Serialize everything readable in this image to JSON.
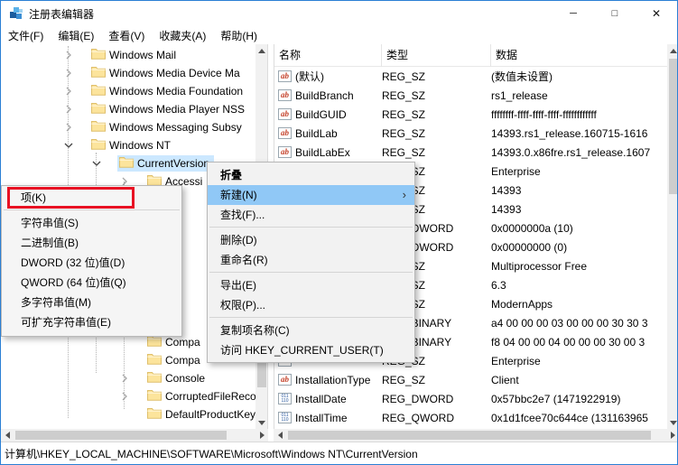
{
  "window": {
    "title": "注册表编辑器",
    "controls": [
      {
        "key": "minimize",
        "glyph": "─"
      },
      {
        "key": "maximize",
        "glyph": "□"
      },
      {
        "key": "close",
        "glyph": "✕"
      }
    ]
  },
  "menubar": [
    {
      "key": "file",
      "label": "文件(F)"
    },
    {
      "key": "edit",
      "label": "编辑(E)"
    },
    {
      "key": "view",
      "label": "查看(V)"
    },
    {
      "key": "favorites",
      "label": "收藏夹(A)"
    },
    {
      "key": "help",
      "label": "帮助(H)"
    }
  ],
  "tree": {
    "items": [
      {
        "label": "Windows Mail",
        "level": 0,
        "state": "collapsed",
        "section": "above_menu"
      },
      {
        "label": "Windows Media Device Ma",
        "level": 0,
        "state": "collapsed",
        "section": "above_menu"
      },
      {
        "label": "Windows Media Foundation",
        "level": 0,
        "state": "collapsed",
        "section": "above_menu"
      },
      {
        "label": "Windows Media Player NSS",
        "level": 0,
        "state": "collapsed",
        "section": "above_menu"
      },
      {
        "label": "Windows Messaging Subsy",
        "level": 0,
        "state": "collapsed",
        "section": "above_menu"
      },
      {
        "label": "Windows NT",
        "level": 0,
        "state": "expanded",
        "section": "above_menu"
      },
      {
        "label": "CurrentVersion",
        "level": 1,
        "state": "expanded",
        "section": "above_menu",
        "selected": true
      },
      {
        "label": "Accessi",
        "level": 2,
        "state": "collapsed",
        "section": "above_menu"
      },
      {
        "label": "Compa",
        "level": 2,
        "state": "leaf",
        "section": "below_menu"
      },
      {
        "label": "Compa",
        "level": 2,
        "state": "leaf",
        "section": "below_menu"
      },
      {
        "label": "Console",
        "level": 2,
        "state": "collapsed",
        "section": "below_menu"
      },
      {
        "label": "CorruptedFileRecove",
        "level": 2,
        "state": "collapsed",
        "section": "below_menu"
      },
      {
        "label": "DefaultProductKey",
        "level": 2,
        "state": "leaf",
        "section": "below_menu"
      }
    ]
  },
  "list": {
    "columns": [
      "名称",
      "类型",
      "数据"
    ],
    "rows": [
      {
        "icon": "string",
        "name": "(默认)",
        "type": "REG_SZ",
        "data": "(数值未设置)"
      },
      {
        "icon": "string",
        "name": "BuildBranch",
        "type": "REG_SZ",
        "data": "rs1_release"
      },
      {
        "icon": "string",
        "name": "BuildGUID",
        "type": "REG_SZ",
        "data": "ffffffff-ffff-ffff-ffff-ffffffffffff"
      },
      {
        "icon": "string",
        "name": "BuildLab",
        "type": "REG_SZ",
        "data": "14393.rs1_release.160715-1616"
      },
      {
        "icon": "string",
        "name": "BuildLabEx",
        "type": "REG_SZ",
        "data": "14393.0.x86fre.rs1_release.1607"
      },
      {
        "icon": "string",
        "name": "",
        "type": "REG_SZ",
        "data": "Enterprise"
      },
      {
        "icon": "string",
        "name": "",
        "type": "REG_SZ",
        "data": "14393"
      },
      {
        "icon": "string",
        "name": "",
        "type": "REG_SZ",
        "data": "14393"
      },
      {
        "icon": "binary",
        "name": "",
        "type": "REG_DWORD",
        "data": "0x0000000a (10)"
      },
      {
        "icon": "binary",
        "name": "",
        "type": "REG_DWORD",
        "data": "0x00000000 (0)"
      },
      {
        "icon": "string",
        "name": "",
        "type": "REG_SZ",
        "data": "Multiprocessor Free"
      },
      {
        "icon": "string",
        "name": "",
        "type": "REG_SZ",
        "data": "6.3"
      },
      {
        "icon": "string",
        "name": "",
        "type": "REG_SZ",
        "data": "ModernApps"
      },
      {
        "icon": "binary",
        "name": "",
        "type": "REG_BINARY",
        "data": "a4 00 00 00 03 00 00 00 30 30 3"
      },
      {
        "icon": "binary",
        "name": "",
        "type": "REG_BINARY",
        "data": "f8 04 00 00 04 00 00 00 30 00 3"
      },
      {
        "icon": "string",
        "name": "",
        "type": "REG_SZ",
        "data": "Enterprise"
      },
      {
        "icon": "string",
        "name": "InstallationType",
        "type": "REG_SZ",
        "data": "Client"
      },
      {
        "icon": "binary",
        "name": "InstallDate",
        "type": "REG_DWORD",
        "data": "0x57bbc2e7 (1471922919)"
      },
      {
        "icon": "binary",
        "name": "InstallTime",
        "type": "REG_QWORD",
        "data": "0x1d1fcee70c644ce (131163965"
      }
    ]
  },
  "context_menu": {
    "items": [
      {
        "key": "collapse",
        "label": "折叠",
        "bold": true
      },
      {
        "key": "new",
        "label": "新建(N)",
        "highlighted": true,
        "has_submenu": true
      },
      {
        "key": "find",
        "label": "查找(F)..."
      },
      {
        "separator": true
      },
      {
        "key": "delete",
        "label": "删除(D)"
      },
      {
        "key": "rename",
        "label": "重命名(R)"
      },
      {
        "separator": true
      },
      {
        "key": "export",
        "label": "导出(E)"
      },
      {
        "key": "permissions",
        "label": "权限(P)..."
      },
      {
        "separator": true
      },
      {
        "key": "copy-key-name",
        "label": "复制项名称(C)"
      },
      {
        "key": "goto-hkcu",
        "label": "访问 HKEY_CURRENT_USER(T)"
      }
    ]
  },
  "submenu": {
    "items": [
      {
        "key": "key",
        "label": "项(K)",
        "annotated": true
      },
      {
        "separator": true
      },
      {
        "key": "string-value",
        "label": "字符串值(S)"
      },
      {
        "key": "binary-value",
        "label": "二进制值(B)"
      },
      {
        "key": "dword-value",
        "label": "DWORD (32 位)值(D)"
      },
      {
        "key": "qword-value",
        "label": "QWORD (64 位)值(Q)"
      },
      {
        "key": "multi-string",
        "label": "多字符串值(M)"
      },
      {
        "key": "expandable-string",
        "label": "可扩充字符串值(E)"
      }
    ]
  },
  "statusbar": {
    "path": "计算机\\HKEY_LOCAL_MACHINE\\SOFTWARE\\Microsoft\\Windows NT\\CurrentVersion"
  },
  "icons": {
    "string_glyph": "ab",
    "binary_top": "011",
    "binary_bottom": "110",
    "submenu_arrow": "›"
  },
  "colors": {
    "accent_border": "#2a7fd4",
    "tree_selection": "#cce8ff",
    "menu_highlight": "#90c8f6",
    "annotation_red": "#e81123",
    "folder_fill": "#fce49c",
    "string_icon": "#c33f27",
    "binary_icon": "#2b5aa0"
  }
}
